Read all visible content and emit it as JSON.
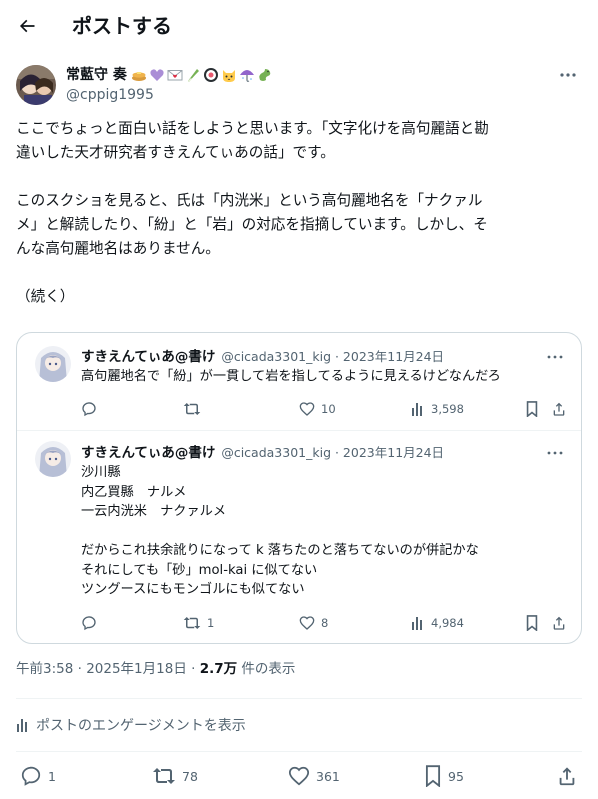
{
  "header": {
    "back_icon": "arrow-left-icon",
    "title": "ポストする"
  },
  "post": {
    "author_name": "常藍守 奏",
    "author_emojis": [
      "pancake-icon",
      "purple-heart-icon",
      "love-letter-icon",
      "leek-icon",
      "sushi-icon",
      "cat-face-icon",
      "umbrella-icon",
      "dragon-icon"
    ],
    "author_handle": "@cppig1995",
    "body_lines": [
      "ここでちょっと面白い話をしようと思います。「文字化けを高句麗語と勘",
      "違いした天才研究者すきえんてぃあの話」です。",
      "",
      "このスクショを見ると、氏は「内洸米」という高句麗地名を「ナクァル",
      "メ」と解読したり、「紛」と「岩」の対応を指摘しています。しかし、そ",
      "んな高句麗地名はありません。",
      "",
      "（続く）"
    ],
    "timestamp": "午前3:58 · 2025年1月18日 · ",
    "views_count": "2.7万",
    "views_label": " 件の表示",
    "engagement_label": "ポストのエンゲージメントを表示",
    "replies": "1",
    "reposts": "78",
    "likes": "361",
    "bookmarks": "95"
  },
  "quoted": [
    {
      "name": "すきえんてぃあ@書け",
      "handle_date": "@cicada3301_kig · 2023年11月24日",
      "lines": [
        "高句麗地名で「紛」が一貫して岩を指してるように見えるけどなんだろ"
      ],
      "replies": "",
      "reposts": "",
      "likes": "10",
      "views": "3,598"
    },
    {
      "name": "すきえんてぃあ@書け",
      "handle_date": "@cicada3301_kig · 2023年11月24日",
      "lines": [
        "沙川縣",
        "内乙買縣　ナルメ",
        "一云内洸米　ナクァルメ",
        "",
        "だからこれ扶余訛りになって k 落ちたのと落ちてないのが併記かな",
        "それにしても「砂」mol-kai に似てない",
        "ツングースにもモンゴルにも似てない"
      ],
      "replies": "",
      "reposts": "1",
      "likes": "8",
      "views": "4,984"
    }
  ],
  "colors": {
    "text": "#0f1419",
    "secondary": "#536471",
    "border": "#cfd9de",
    "divider": "#eff3f4"
  }
}
